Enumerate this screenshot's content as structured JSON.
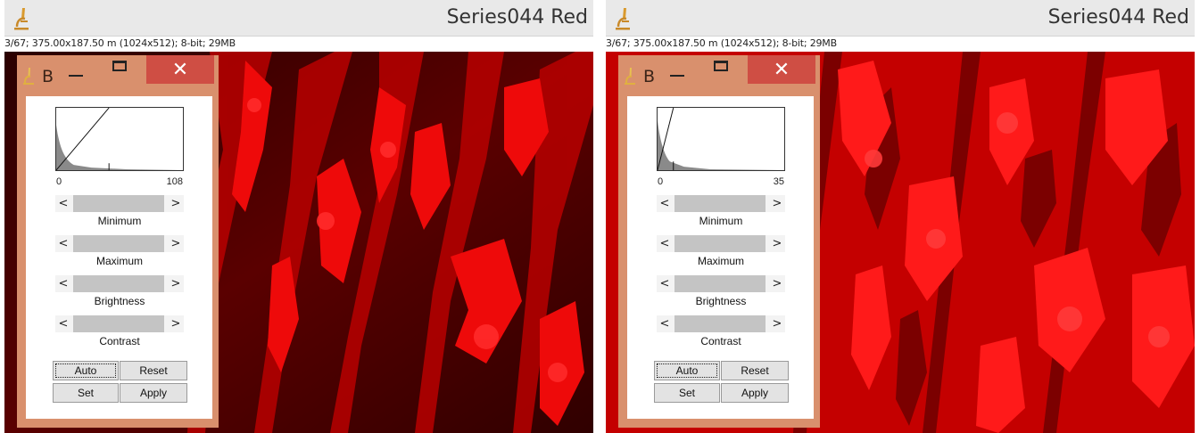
{
  "windows": [
    {
      "title": "Series044 Red",
      "info": "3/67; 375.00x187.50 m (1024x512); 8-bit; 29MB",
      "panel": {
        "letter": "B",
        "close_label": "✕",
        "hist_min": "0",
        "hist_max": "108",
        "sliders": [
          "Minimum",
          "Maximum",
          "Brightness",
          "Contrast"
        ],
        "left_arrow": "<",
        "right_arrow": ">",
        "buttons": {
          "auto": "Auto",
          "reset": "Reset",
          "set": "Set",
          "apply": "Apply"
        }
      }
    },
    {
      "title": "Series044 Red",
      "info": "3/67; 375.00x187.50 m (1024x512); 8-bit; 29MB",
      "panel": {
        "letter": "B",
        "close_label": "✕",
        "hist_min": "0",
        "hist_max": "35",
        "sliders": [
          "Minimum",
          "Maximum",
          "Brightness",
          "Contrast"
        ],
        "left_arrow": "<",
        "right_arrow": ">",
        "buttons": {
          "auto": "Auto",
          "reset": "Reset",
          "set": "Set",
          "apply": "Apply"
        }
      }
    }
  ],
  "colors": {
    "panel_border": "#d9906d",
    "close_button": "#cf4e44",
    "image_red_dim": "#a00000",
    "image_red_bright": "#ff1010"
  },
  "icons": {
    "app": "microscope-icon",
    "close": "close-icon",
    "minimize": "minimize-icon",
    "maximize": "maximize-icon"
  }
}
